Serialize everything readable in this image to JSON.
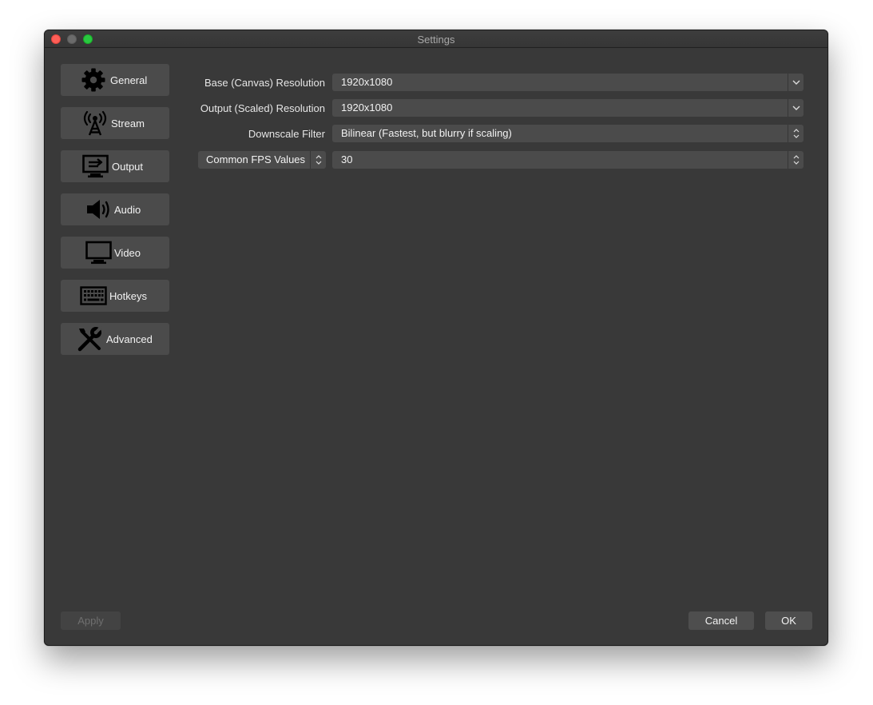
{
  "window": {
    "title": "Settings"
  },
  "sidebar": {
    "items": [
      {
        "label": "General",
        "icon": "gear-icon"
      },
      {
        "label": "Stream",
        "icon": "antenna-icon"
      },
      {
        "label": "Output",
        "icon": "monitor-output-icon"
      },
      {
        "label": "Audio",
        "icon": "speaker-icon"
      },
      {
        "label": "Video",
        "icon": "monitor-icon"
      },
      {
        "label": "Hotkeys",
        "icon": "keyboard-icon"
      },
      {
        "label": "Advanced",
        "icon": "tools-icon"
      }
    ]
  },
  "video": {
    "base_resolution_label": "Base (Canvas) Resolution",
    "base_resolution_value": "1920x1080",
    "output_resolution_label": "Output (Scaled) Resolution",
    "output_resolution_value": "1920x1080",
    "downscale_filter_label": "Downscale Filter",
    "downscale_filter_value": "Bilinear (Fastest, but blurry if scaling)",
    "fps_type_value": "Common FPS Values",
    "fps_value": "30"
  },
  "footer": {
    "apply_label": "Apply",
    "cancel_label": "Cancel",
    "ok_label": "OK"
  },
  "colors": {
    "window_bg": "#393939",
    "control_bg": "#4b4b4b",
    "close": "#fe5f57",
    "maximize": "#29c940"
  }
}
